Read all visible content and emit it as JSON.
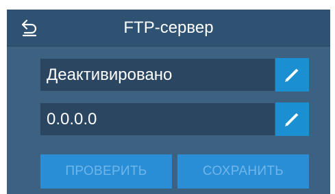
{
  "header": {
    "title": "FTP-сервер",
    "back_icon": "back-arrow-icon"
  },
  "fields": [
    {
      "value": "Деактивировано",
      "edit_icon": "pencil-icon"
    },
    {
      "value": "0.0.0.0",
      "edit_icon": "pencil-icon"
    }
  ],
  "buttons": {
    "check_label": "ПРОВЕРИТЬ",
    "save_label": "СОХРАНИТЬ"
  },
  "colors": {
    "background": "#3d6281",
    "header": "#2f5273",
    "field": "#2a4660",
    "accent": "#1a8fd1",
    "button": "#2a8ed6",
    "button_text_disabled": "#6fb6ea"
  }
}
